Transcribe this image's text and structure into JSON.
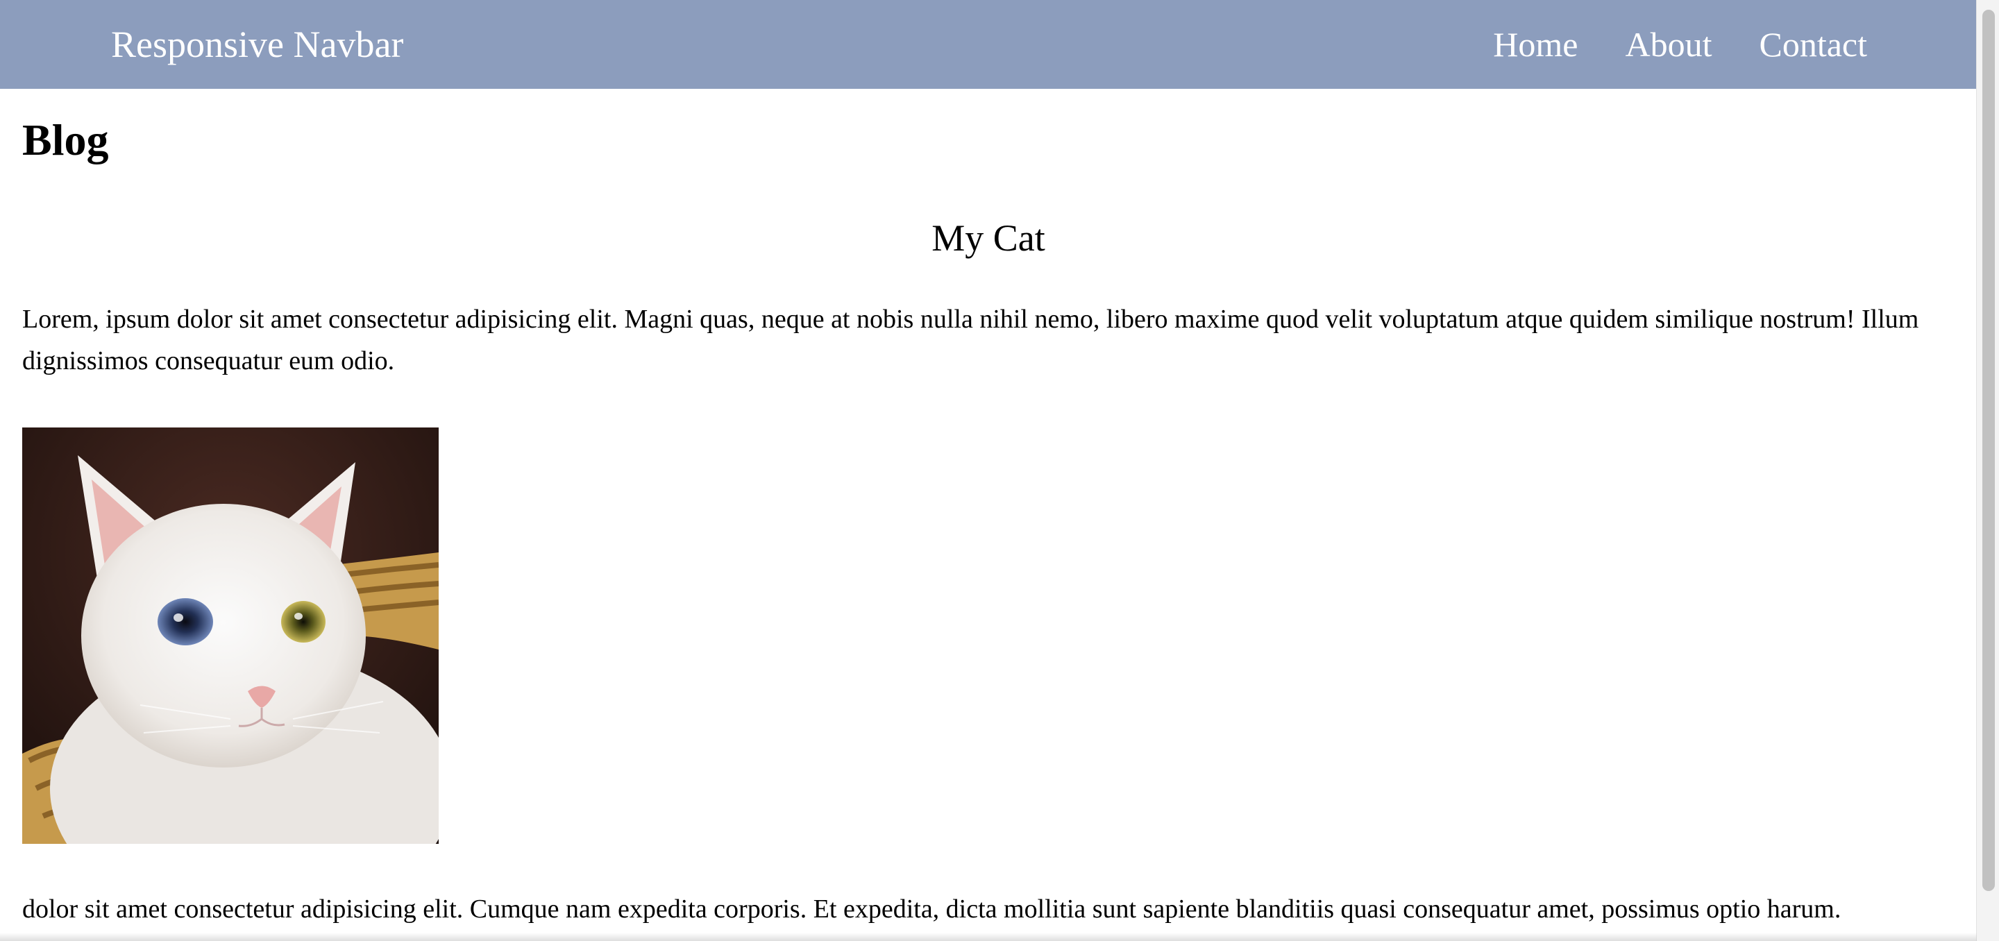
{
  "navbar": {
    "brand": "Responsive Navbar",
    "links": [
      "Home",
      "About",
      "Contact"
    ],
    "bg_color": "#8c9dbd"
  },
  "main": {
    "heading": "Blog",
    "post": {
      "title": "My Cat",
      "paragraph_1": "Lorem, ipsum dolor sit amet consectetur adipisicing elit. Magni quas, neque at nobis nulla nihil nemo, libero maxime quod velit voluptatum atque quidem similique nostrum! Illum dignissimos consequatur eum odio.",
      "paragraph_2": "dolor sit amet consectetur adipisicing elit. Cumque nam expedita corporis. Et expedita, dicta mollitia sunt sapiente blanditiis quasi consequatur amet, possimus optio harum."
    }
  }
}
